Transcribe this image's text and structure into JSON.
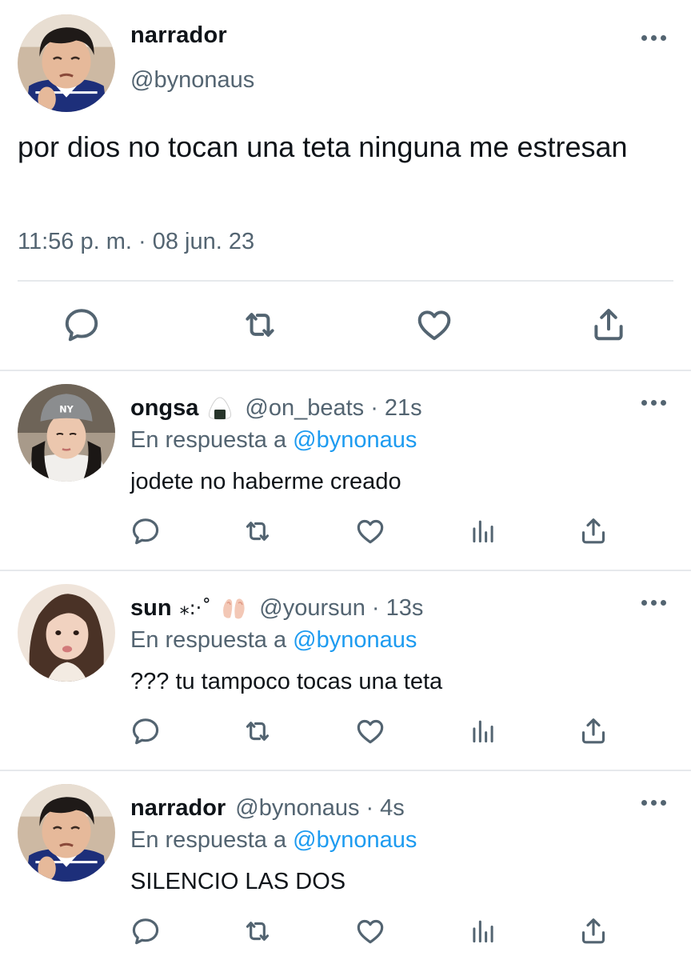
{
  "main_tweet": {
    "author_name": "narrador",
    "author_handle": "@bynonaus",
    "text": "por dios no tocan una teta ninguna me estresan",
    "timestamp": "11:56 p. m. · 08 jun. 23",
    "avatar": "avatar-photo-young-man",
    "actions": [
      "reply-icon",
      "retweet-icon",
      "like-icon",
      "share-icon"
    ]
  },
  "replies": [
    {
      "author_name": "ongsa",
      "emoji": "onigiri-emoji",
      "author_handle": "@on_beats",
      "dot": "·",
      "time": "21s",
      "reply_prefix": "En respuesta a",
      "reply_mention": "@bynonaus",
      "text": "jodete no haberme creado",
      "avatar": "avatar-photo-girl-cap"
    },
    {
      "author_name": "sun",
      "emoji": "sparkle-kaomoji ⁎:·˚ + peach-emoji",
      "emoji_text": "⁎:·˚",
      "author_handle": "@yoursun",
      "dot": "·",
      "time": "13s",
      "reply_prefix": "En respuesta a",
      "reply_mention": "@bynonaus",
      "text": "??? tu tampoco tocas una teta",
      "avatar": "avatar-photo-girl-long-hair"
    },
    {
      "author_name": "narrador",
      "author_handle": "@bynonaus",
      "dot": "·",
      "time": "4s",
      "reply_prefix": "En respuesta a",
      "reply_mention": "@bynonaus",
      "text": "SILENCIO LAS DOS",
      "avatar": "avatar-photo-young-man"
    }
  ],
  "reply_actions": [
    "reply-icon",
    "retweet-icon",
    "like-icon",
    "analytics-icon",
    "share-icon"
  ],
  "colors": {
    "text": "#0f1419",
    "secondary": "#536471",
    "link": "#1d9bf0",
    "divider": "#e6e9ec"
  }
}
